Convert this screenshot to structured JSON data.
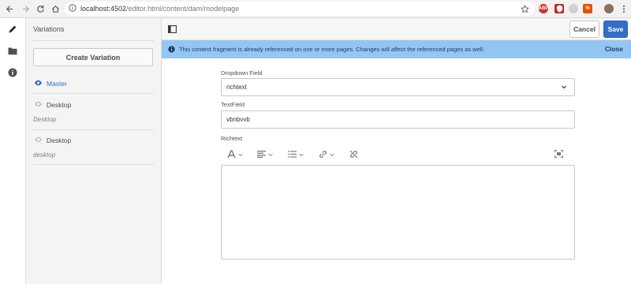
{
  "browser": {
    "url_host": "localhost:4502",
    "url_path": "/editor.html/content/dam/modelpage"
  },
  "panel": {
    "title": "Variations",
    "create_label": "Create Variation",
    "variations": [
      {
        "label": "Master",
        "description": "",
        "active": true
      },
      {
        "label": "Desktop",
        "description": "Desktop",
        "active": false
      },
      {
        "label": "Desktop",
        "description": "desktop",
        "active": false
      }
    ]
  },
  "toolbar": {
    "cancel_label": "Cancel",
    "save_label": "Save"
  },
  "alert": {
    "message": "This content fragment is already referenced on one or more pages. Changes will affect the referenced pages as well.",
    "close_label": "Close"
  },
  "form": {
    "dropdown_label": "Dropdown Field",
    "dropdown_value": "richtext",
    "textfield_label": "TextField",
    "textfield_value": "vbnbvvb",
    "richtext_label": "Richtext",
    "richtext_value": ""
  },
  "colors": {
    "accent": "#326ec8",
    "alert_bg": "#93c6f2",
    "active_variation": "#326ec8"
  }
}
